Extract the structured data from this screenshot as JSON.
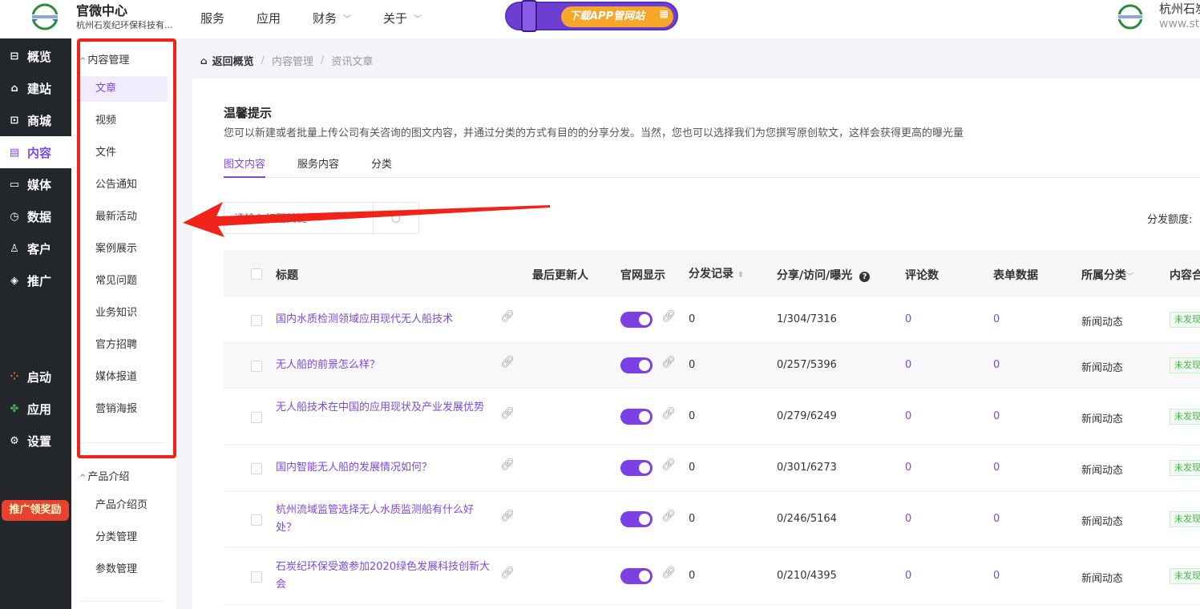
{
  "header": {
    "brand_title": "官微中心",
    "brand_sub": "杭州石炭纪环保科技有...",
    "nav": [
      {
        "label": "服务",
        "has_dropdown": false
      },
      {
        "label": "应用",
        "has_dropdown": false
      },
      {
        "label": "财务",
        "has_dropdown": true
      },
      {
        "label": "关于",
        "has_dropdown": true
      }
    ],
    "app_banner": "下载APP管网站",
    "right_name": "杭州石炭",
    "right_url": "www.st"
  },
  "sidebar": {
    "items": [
      {
        "label": "概览",
        "icon": "overview-icon"
      },
      {
        "label": "建站",
        "icon": "home-icon"
      },
      {
        "label": "商城",
        "icon": "cart-icon"
      },
      {
        "label": "内容",
        "icon": "document-icon",
        "active": true
      },
      {
        "label": "媒体",
        "icon": "video-icon"
      },
      {
        "label": "数据",
        "icon": "clock-icon"
      },
      {
        "label": "客户",
        "icon": "user-icon"
      },
      {
        "label": "推广",
        "icon": "tag-icon"
      },
      {
        "label": "启动",
        "icon": "dots-icon"
      },
      {
        "label": "应用",
        "icon": "apps-icon"
      },
      {
        "label": "设置",
        "icon": "gear-icon"
      }
    ],
    "promo": "推广领奖励"
  },
  "submenu": {
    "group1": "内容管理",
    "group1_items": [
      "文章",
      "视频",
      "文件",
      "公告通知",
      "最新活动",
      "案例展示",
      "常见问题",
      "业务知识",
      "官方招聘",
      "媒体报道",
      "营销海报"
    ],
    "group2": "产品介绍",
    "group2_items": [
      "产品介绍页",
      "分类管理",
      "参数管理"
    ]
  },
  "breadcrumb": {
    "home": "返回概览",
    "items": [
      "内容管理",
      "资讯文章"
    ]
  },
  "panel": {
    "tip_title": "温馨提示",
    "tip_desc": "您可以新建或者批量上传公司有关咨询的图文内容，并通过分类的方式有目的的分享分发。当然，您也可以选择我们为您撰写原创软文，这样会获得更高的曝光量",
    "tabs": [
      "图文内容",
      "服务内容",
      "分类"
    ],
    "search_placeholder": "请输入标题关键",
    "quota_label": "分发额度:"
  },
  "table": {
    "headers": {
      "title": "标题",
      "updater": "最后更新人",
      "site_display": "官网显示",
      "dist_records": "分发记录",
      "share_stats": "分享/访问/曝光",
      "comments": "评论数",
      "form_data": "表单数据",
      "category": "所属分类",
      "content_status": "内容合"
    },
    "rows": [
      {
        "title": "国内水质检测领域应用现代无人船技术",
        "dist": "0",
        "stats": "1/304/7316",
        "comments": "0",
        "forms": "0",
        "category": "新闻动态",
        "status": "未发现",
        "visible": true
      },
      {
        "title": "无人船的前景怎么样？",
        "dist": "0",
        "stats": "0/257/5396",
        "comments": "0",
        "forms": "0",
        "category": "新闻动态",
        "status": "未发现",
        "visible": true
      },
      {
        "title": "无人船技术在中国的应用现状及产业发展优势",
        "dist": "0",
        "stats": "0/279/6249",
        "comments": "0",
        "forms": "0",
        "category": "新闻动态",
        "status": "未发现",
        "visible": true
      },
      {
        "title": "国内智能无人船的发展情况如何？",
        "dist": "0",
        "stats": "0/301/6273",
        "comments": "0",
        "forms": "0",
        "category": "新闻动态",
        "status": "未发现",
        "visible": true
      },
      {
        "title": "杭州流域监管选择无人水质监测船有什么好处？",
        "dist": "0",
        "stats": "0/246/5164",
        "comments": "0",
        "forms": "0",
        "category": "新闻动态",
        "status": "未发现",
        "visible": true
      },
      {
        "title": "石炭纪环保受邀参加2020绿色发展科技创新大会",
        "dist": "0",
        "stats": "0/210/4395",
        "comments": "0",
        "forms": "0",
        "category": "新闻动态",
        "status": "未发现",
        "visible": true
      }
    ]
  },
  "colors": {
    "accent": "#7b4ae0",
    "sidebar_bg": "#23262b",
    "annotation_red": "#f1221a"
  }
}
